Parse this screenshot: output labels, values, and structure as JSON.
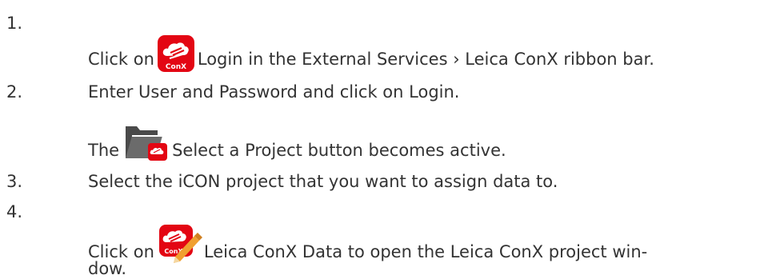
{
  "steps": [
    {
      "number": "1.",
      "text_before": "Click on",
      "icon": "conx-login-icon",
      "text_after": "Login in the External Services › Leica ConX ribbon bar."
    },
    {
      "number": "2.",
      "text": "Enter User and Password and click on Login.",
      "sub": {
        "text_before": "The",
        "icon": "select-project-folder-icon",
        "text_after": "Select a Project button becomes active."
      }
    },
    {
      "number": "3.",
      "text": "Select the iCON project that you want to assign data to."
    },
    {
      "number": "4.",
      "text_before": "Click on",
      "icon": "conx-data-edit-icon",
      "text_after": "Leica ConX Data to open the Leica ConX project win-",
      "continuation": "dow."
    }
  ],
  "icon_labels": {
    "conx": "ConX"
  },
  "colors": {
    "text": "#333333",
    "brand_red": "#e30613",
    "folder_gray": "#555555",
    "pencil_orange": "#f0a030"
  }
}
